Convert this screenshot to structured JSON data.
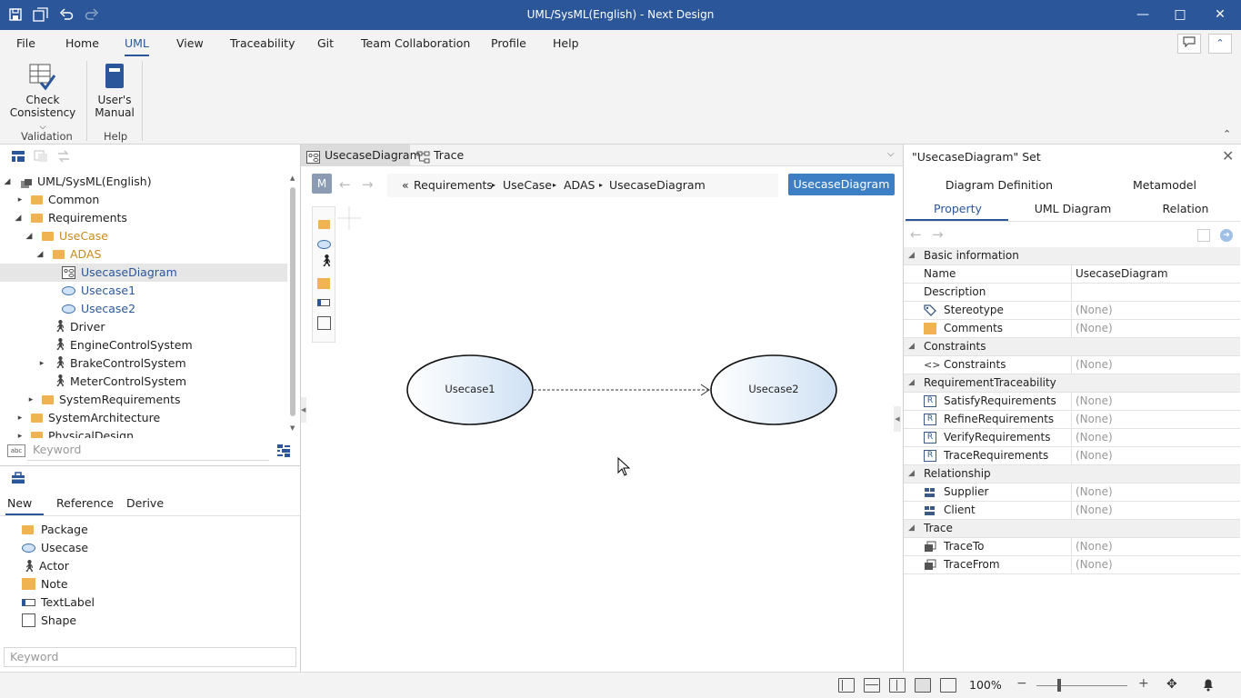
{
  "window": {
    "title": "UML/SysML(English) - Next Design"
  },
  "menu": [
    "File",
    "Home",
    "UML",
    "View",
    "Traceability",
    "Git",
    "Team Collaboration",
    "Profile",
    "Help"
  ],
  "ribbon": {
    "check_line1": "Check",
    "check_line2": "Consistency",
    "manual_line1": "User's",
    "manual_line2": "Manual",
    "group_validation": "Validation",
    "group_help": "Help"
  },
  "tree": [
    {
      "label": "UML/SysML(English)"
    },
    {
      "label": "Common"
    },
    {
      "label": "Requirements"
    },
    {
      "label": "UseCase"
    },
    {
      "label": "ADAS"
    },
    {
      "label": "UsecaseDiagram"
    },
    {
      "label": "Usecase1"
    },
    {
      "label": "Usecase2"
    },
    {
      "label": "Driver"
    },
    {
      "label": "EngineControlSystem"
    },
    {
      "label": "BrakeControlSystem"
    },
    {
      "label": "MeterControlSystem"
    },
    {
      "label": "SystemRequirements"
    },
    {
      "label": "SystemArchitecture"
    },
    {
      "label": "PhysicalDesign"
    }
  ],
  "tree_search_placeholder": "Keyword",
  "toolbox": {
    "tabs": [
      "New",
      "Reference",
      "Derive"
    ],
    "items": [
      "Package",
      "Usecase",
      "Actor",
      "Note",
      "TextLabel",
      "Shape"
    ],
    "search_placeholder": "Keyword"
  },
  "editor": {
    "tabs": [
      "UsecaseDiagram",
      "Trace"
    ],
    "model_badge": "M",
    "breadcrumb_prefix": "«",
    "breadcrumb": [
      "Requirements",
      "UseCase",
      "ADAS",
      "UsecaseDiagram"
    ],
    "view_button": "UsecaseDiagram",
    "usecase1": "Usecase1",
    "usecase2": "Usecase2"
  },
  "inspector": {
    "title": "\"UsecaseDiagram\" Set",
    "tabs_row1": [
      "Diagram Definition",
      "Metamodel"
    ],
    "tabs_row2": [
      "Property",
      "UML Diagram",
      "Relation"
    ],
    "cat_basic": "Basic information",
    "name_label": "Name",
    "name_value": "UsecaseDiagram",
    "desc_label": "Description",
    "stereo_label": "Stereotype",
    "stereo_value": "(None)",
    "comments_label": "Comments",
    "comments_value": "(None)",
    "cat_constraints": "Constraints",
    "constraints_label": "Constraints",
    "constraints_value": "(None)",
    "cat_reqtrace": "RequirementTraceability",
    "satisfy_label": "SatisfyRequirements",
    "satisfy_value": "(None)",
    "refine_label": "RefineRequirements",
    "refine_value": "(None)",
    "verify_label": "VerifyRequirements",
    "verify_value": "(None)",
    "tracereq_label": "TraceRequirements",
    "tracereq_value": "(None)",
    "cat_relationship": "Relationship",
    "supplier_label": "Supplier",
    "supplier_value": "(None)",
    "client_label": "Client",
    "client_value": "(None)",
    "cat_trace": "Trace",
    "traceto_label": "TraceTo",
    "traceto_value": "(None)",
    "tracefrom_label": "TraceFrom",
    "tracefrom_value": "(None)"
  },
  "status": {
    "zoom": "100%",
    "minus": "−",
    "plus": "+"
  },
  "colors": {
    "accent": "#2b579a",
    "folder": "#f0b352",
    "button": "#3c7fc4"
  }
}
